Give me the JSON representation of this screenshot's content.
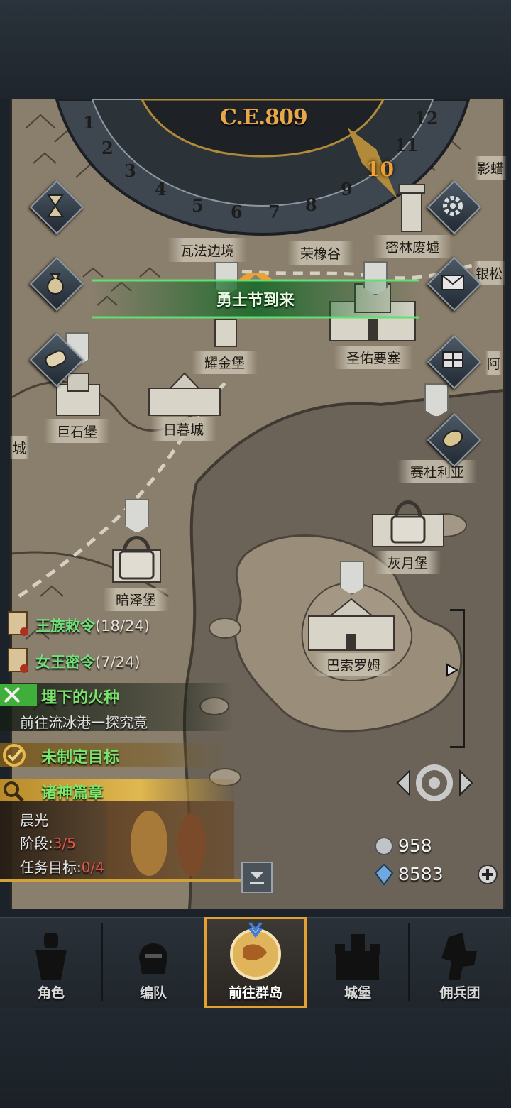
{
  "calendar": {
    "era_label": "C.E.809",
    "months": [
      "1",
      "2",
      "3",
      "4",
      "5",
      "6",
      "7",
      "8",
      "9",
      "10",
      "11",
      "12"
    ],
    "current_month": "10"
  },
  "event_banner": "勇士节到来",
  "locations": {
    "wafa": "瓦法边境",
    "rongxiang": "荣橡谷",
    "milin": "密林废墟",
    "yingtan_partial": "影蜡",
    "yinsong_partial": "银松",
    "yaojin": "耀金堡",
    "shengyou": "圣佑要塞",
    "a_partial": "阿",
    "jushi": "巨石堡",
    "rimu": "日暮城",
    "cheng_partial": "城",
    "saiduliya": "赛杜利亚",
    "huiyue": "灰月堡",
    "anze": "暗泽堡",
    "basuoluomu": "巴索罗姆"
  },
  "quests": [
    {
      "title": "王族敕令",
      "count": "(18/24)"
    },
    {
      "title": "女王密令",
      "count": "(7/24)"
    }
  ],
  "main_quest": {
    "title": "埋下的火种",
    "desc": "前往流冰港一探究竟"
  },
  "goal": "未制定目标",
  "saga": {
    "title": "诸神篇章",
    "name": "晨光",
    "stage_label": "阶段:",
    "stage_value": "3/5",
    "target_label": "任务目标:",
    "target_value": "0/4"
  },
  "currency": {
    "silver": "958",
    "crystal": "8583"
  },
  "nav": [
    {
      "label": "角色",
      "icon": "knight-icon"
    },
    {
      "label": "编队",
      "icon": "helmet-icon"
    },
    {
      "label": "前往群岛",
      "icon": "globe-icon"
    },
    {
      "label": "城堡",
      "icon": "castle-icon"
    },
    {
      "label": "佣兵团",
      "icon": "mercenary-icon"
    }
  ],
  "colors": {
    "quest_green": "#6fe07a",
    "accent_gold": "#e4a033",
    "stage_red": "#e0584a",
    "map_parchment": "#8a7e6c"
  }
}
